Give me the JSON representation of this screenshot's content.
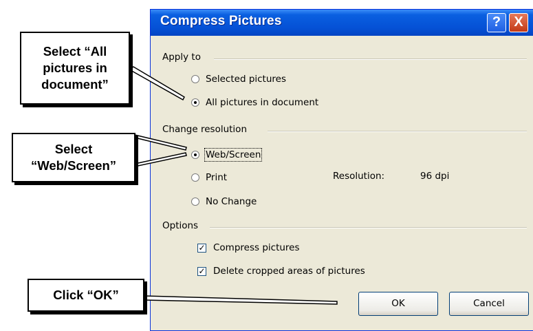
{
  "dialog": {
    "title": "Compress Pictures",
    "help_symbol": "?",
    "close_symbol": "X",
    "apply_to": {
      "label": "Apply to",
      "options": [
        {
          "label": "Selected pictures",
          "selected": false
        },
        {
          "label": "All pictures in document",
          "selected": true
        }
      ]
    },
    "change_resolution": {
      "label": "Change resolution",
      "options": [
        {
          "label": "Web/Screen",
          "selected": true
        },
        {
          "label": "Print",
          "selected": false
        },
        {
          "label": "No Change",
          "selected": false
        }
      ],
      "resolution_label": "Resolution:",
      "resolution_value": "96 dpi"
    },
    "options": {
      "label": "Options",
      "items": [
        {
          "label": "Compress pictures",
          "checked": true
        },
        {
          "label": "Delete cropped areas of pictures",
          "checked": true
        }
      ]
    },
    "ok_label": "OK",
    "cancel_label": "Cancel"
  },
  "callouts": {
    "apply_to": "Select “All pictures in document”",
    "resolution": "Select “Web/Screen”",
    "ok": "Click “OK”"
  },
  "colors": {
    "titlebar": "#0551d6",
    "dialog_bg": "#ece9d8",
    "close_button": "#c23a16"
  }
}
